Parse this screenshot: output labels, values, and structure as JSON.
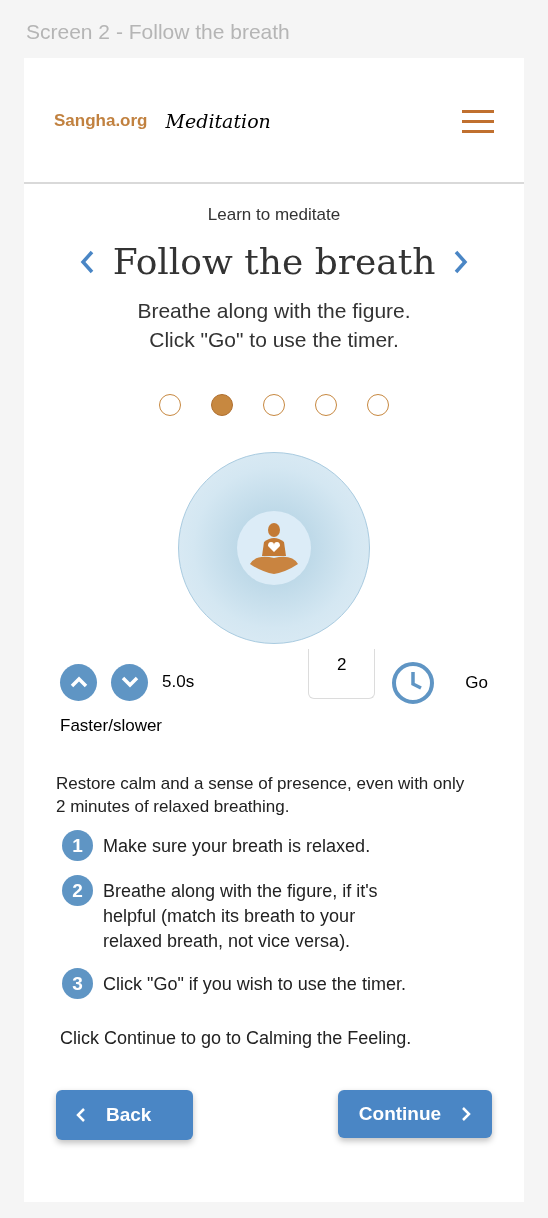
{
  "screen_label": "Screen 2 - Follow the breath",
  "header": {
    "brand": "Sangha.org",
    "product": "Meditation"
  },
  "section": "Learn to meditate",
  "title": "Follow the breath",
  "subtitle_lines": [
    "Breathe along with the figure.",
    "Click \"Go\" to use the timer."
  ],
  "steps": [
    {
      "selected": false
    },
    {
      "selected": true
    },
    {
      "selected": false
    },
    {
      "selected": false
    },
    {
      "selected": false
    }
  ],
  "pace": {
    "reading": "5.0s",
    "label": "Faster/slower"
  },
  "timer": {
    "value": "2",
    "go": "Go"
  },
  "intro": "Restore calm and a sense of presence, even with only 2 minutes of relaxed breathing.",
  "instructions": [
    {
      "number": "1",
      "text": "Make sure your breath is relaxed."
    },
    {
      "number": "2",
      "text": "Breathe along with the figure, if it's helpful (match its breath to your relaxed breath, not vice versa)."
    },
    {
      "number": "3",
      "text": "Click \"Go\" if you wish to use the timer."
    }
  ],
  "continue_note": "Click Continue to go to Calming the Feeling.",
  "buttons": {
    "back": "Back",
    "continue": "Continue"
  }
}
